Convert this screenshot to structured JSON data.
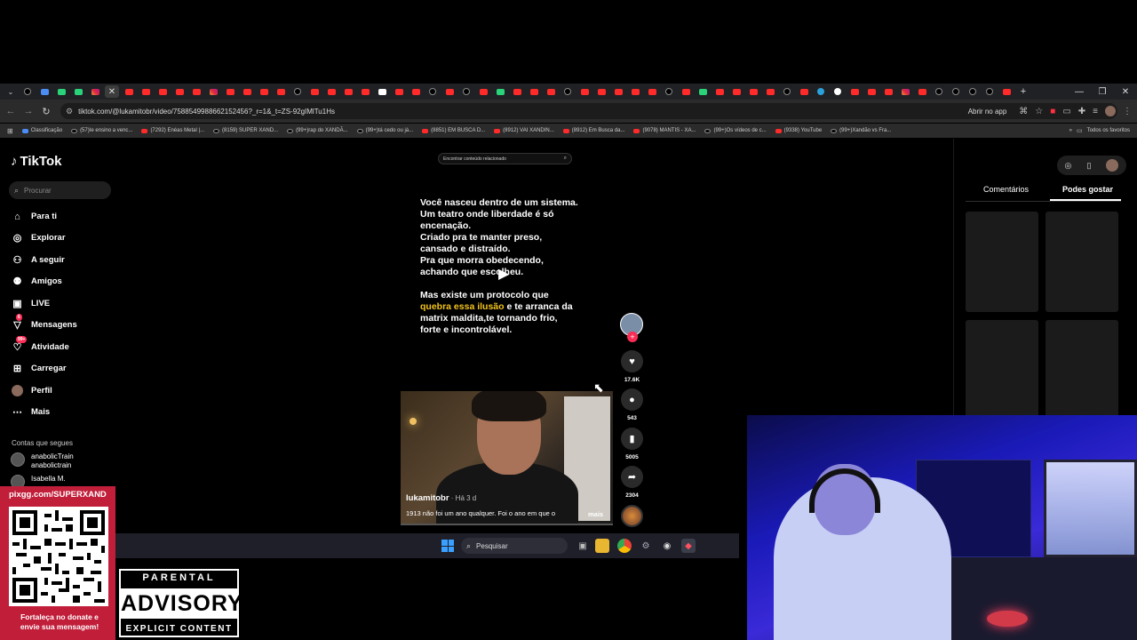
{
  "browser": {
    "url": "tiktok.com/@lukamitobr/video/7588549988662152456?_r=1&_t=ZS-92gIMlTu1Hs",
    "open_in_app": "Abrir no app",
    "tabs": [
      "tt",
      "bl",
      "gr",
      "gr",
      "ig",
      "x",
      "yt",
      "yt",
      "yt",
      "yt",
      "yt",
      "ig",
      "yt",
      "yt",
      "yt",
      "yt",
      "tt",
      "yt",
      "yt",
      "yt",
      "yt",
      "wt",
      "yt",
      "yt",
      "tt",
      "yt",
      "tt",
      "yt",
      "gr",
      "yt",
      "yt",
      "yt",
      "tt",
      "yt",
      "yt",
      "yt",
      "yt",
      "yt",
      "tt",
      "yt",
      "gr",
      "yt",
      "yt",
      "yt",
      "yt",
      "tt",
      "yt",
      "tg",
      "gg",
      "yt",
      "yt",
      "yt",
      "ig",
      "yt",
      "tt",
      "tt",
      "tt",
      "tt",
      "yt"
    ],
    "bookmarks": [
      {
        "label": "Classificação",
        "icon": "bl"
      },
      {
        "label": "(57)Ie ensino a venc...",
        "icon": "tt"
      },
      {
        "label": "(7292) Enéas Metal |...",
        "icon": "yt"
      },
      {
        "label": "(8159) SUPER XAND...",
        "icon": "tt"
      },
      {
        "label": "(99+)rap do XANDÃ...",
        "icon": "tt"
      },
      {
        "label": "(99+)tá cedo ou já...",
        "icon": "tt"
      },
      {
        "label": "(8851) EM BUSCA D...",
        "icon": "yt"
      },
      {
        "label": "(8912) VAI XANDIN...",
        "icon": "yt"
      },
      {
        "label": "(8912) Em Busca da...",
        "icon": "yt"
      },
      {
        "label": "(9078) MANTIS - XA...",
        "icon": "yt"
      },
      {
        "label": "(99+)Os vídeos de c...",
        "icon": "tt"
      },
      {
        "label": "(9338) YouTube",
        "icon": "yt"
      },
      {
        "label": "(99+)Xandão vs Fra...",
        "icon": "tt"
      }
    ],
    "all_bookmarks": "Todos os favoritos"
  },
  "sidebar": {
    "logo": "TikTok",
    "search_placeholder": "Procurar",
    "items": [
      {
        "label": "Para ti",
        "icon": "home-icon"
      },
      {
        "label": "Explorar",
        "icon": "compass-icon"
      },
      {
        "label": "A seguir",
        "icon": "following-icon"
      },
      {
        "label": "Amigos",
        "icon": "friends-icon"
      },
      {
        "label": "LIVE",
        "icon": "live-icon"
      },
      {
        "label": "Mensagens",
        "icon": "messages-icon"
      },
      {
        "label": "Atividade",
        "icon": "activity-icon"
      },
      {
        "label": "Carregar",
        "icon": "upload-icon"
      },
      {
        "label": "Perfil",
        "icon": "profile-icon"
      },
      {
        "label": "Mais",
        "icon": "more-icon"
      }
    ],
    "messages_badge": "6",
    "activity_badge": "99+",
    "following_title": "Contas que segues",
    "accounts": [
      {
        "name": "anabolicTrain",
        "handle": "anabolictrain"
      },
      {
        "name": "Isabella M.",
        "handle": ""
      }
    ]
  },
  "main": {
    "top_search_placeholder": "Encontrar conteúdo relacionado",
    "video_text": {
      "p1": [
        "Você nasceu dentro de um sistema.",
        "Um teatro onde liberdade é só",
        "encenação.",
        "Criado pra te manter preso,",
        "cansado e distraído.",
        "Pra que morra obedecendo,",
        "achando que escolheu."
      ],
      "p2_line1": "Mas existe um protocolo que",
      "p2_hl": "quebra essa ilusão",
      "p2_line2_rest": " e te arranca da",
      "p2_rest": [
        "matrix maldita,te tornando frio,",
        "forte e incontrolável."
      ]
    },
    "video_user": "lukamitobr",
    "video_date": " · Há 3 d",
    "video_desc": "1913 não foi um ano qualquer. Foi o ano em que o",
    "video_more": "mais",
    "progress": 0.0,
    "actions": {
      "likes": "17.6K",
      "comments": "543",
      "saves": "5005",
      "shares": "2304"
    }
  },
  "right_panel": {
    "tab_comments": "Comentários",
    "tab_liked": "Podes gostar"
  },
  "taskbar": {
    "search_placeholder": "Pesquisar"
  },
  "overlay": {
    "pix_url": "pixgg.com/SUPERXAND",
    "pix_footer_1": "Fortaleça no donate e",
    "pix_footer_2": "envie sua mensagem!",
    "advisory_top": "PARENTAL",
    "advisory_mid": "ADVISORY",
    "advisory_bot": "EXPLICIT CONTENT"
  }
}
